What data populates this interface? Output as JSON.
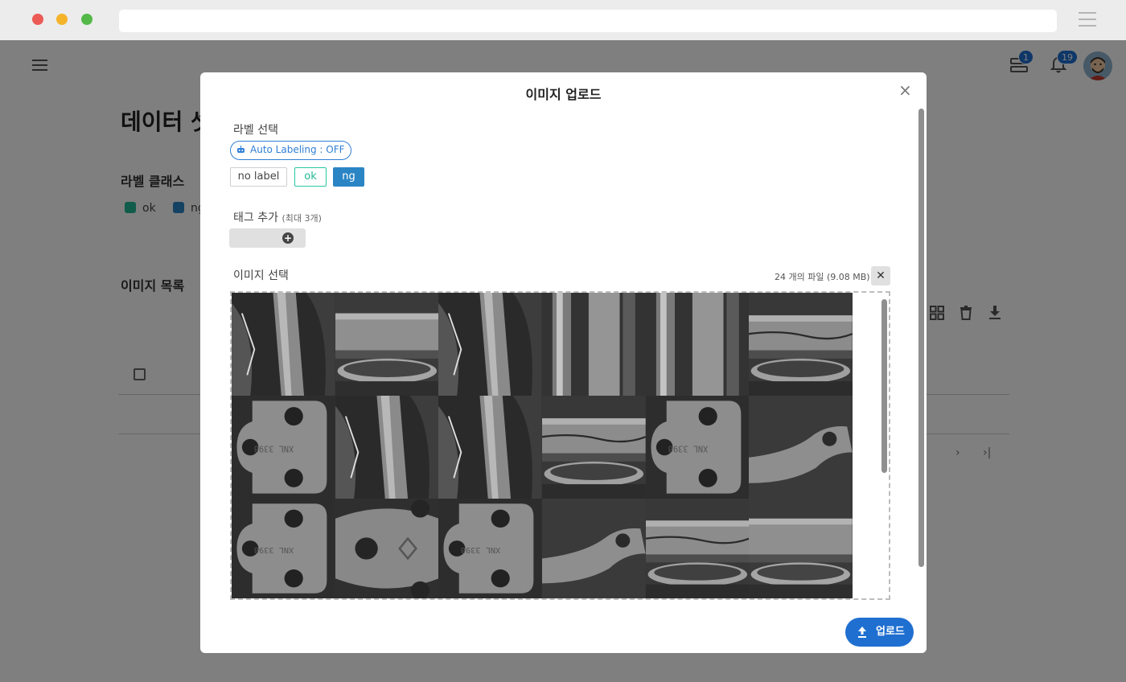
{
  "browser": {
    "address": ""
  },
  "app": {
    "page_title": "데이터 셋",
    "label_class_title": "라벨 클래스",
    "legend": [
      {
        "label": "ok",
        "color": "#22b894"
      },
      {
        "label": "ng",
        "color": "#2b84c4"
      }
    ],
    "image_list_title": "이미지 목록",
    "notifications": {
      "stack_count": "1",
      "bell_count": "19"
    }
  },
  "modal": {
    "title": "이미지 업로드",
    "label_select": "라벨 선택",
    "auto_labeling": "Auto Labeling : OFF",
    "label_buttons": {
      "no_label": "no label",
      "ok": "ok",
      "ng": "ng"
    },
    "tag_add": "태그 추가",
    "tag_hint": "(최대 3개)",
    "image_select": "이미지 선택",
    "file_info": "24 개의 파일 (9.08 MB)",
    "upload": "업로드"
  },
  "colors": {
    "accent": "#1f6fd1",
    "ok": "#22b894",
    "ng": "#2b84c4"
  },
  "thumbnails": [
    "crack-arm",
    "bearing-ring",
    "crack-arm",
    "ring-side",
    "ring-side",
    "bearing-ring-crack",
    "flange-part",
    "crack-arm",
    "crack-arm",
    "bearing-ring-crack",
    "flange-part",
    "link-arm",
    "flange-part",
    "flange-diamond",
    "flange-part",
    "link-arm",
    "bearing-ring-crack",
    "bearing-ring"
  ]
}
